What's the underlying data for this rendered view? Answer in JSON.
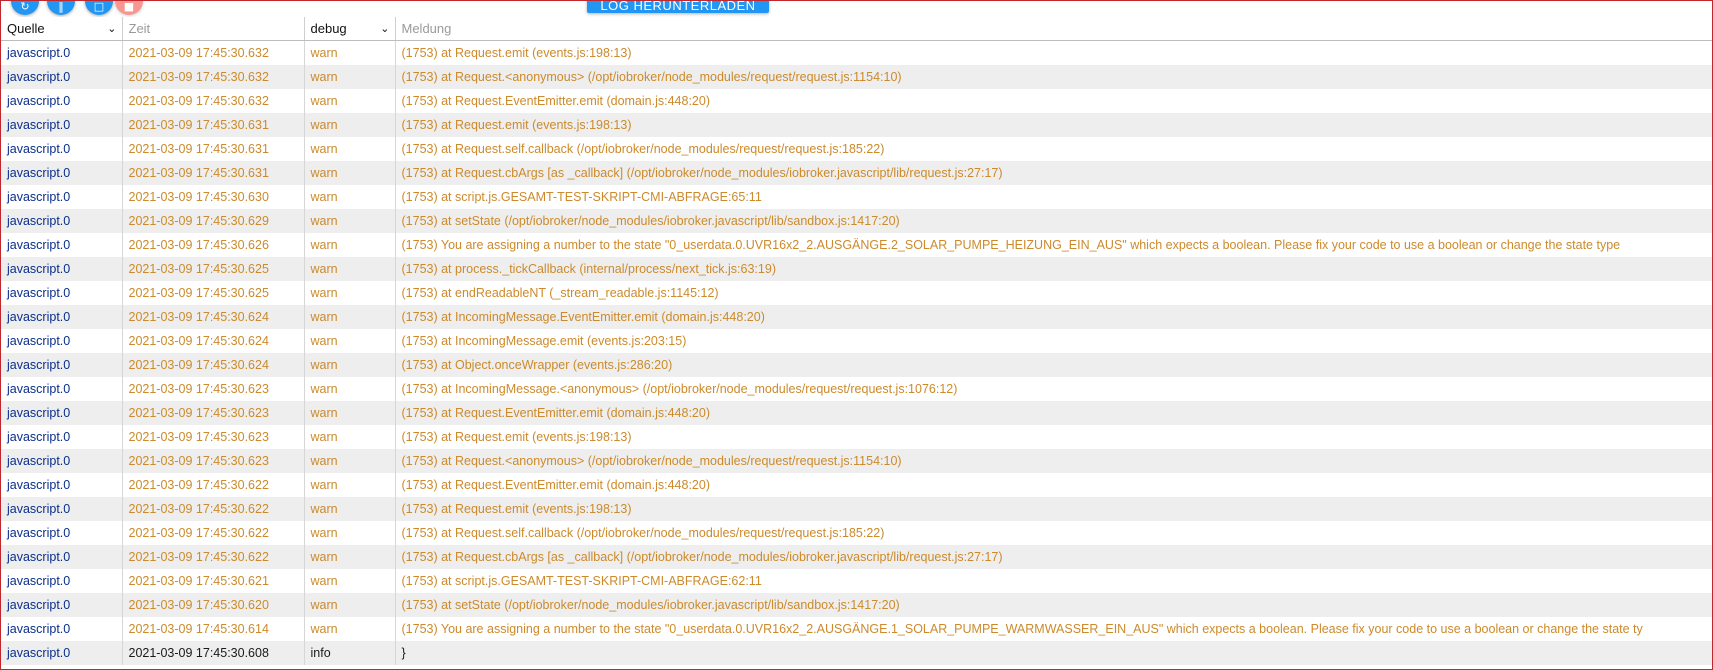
{
  "toolbar": {
    "download_label": "LOG HERUNTERLADEN",
    "icons": [
      "refresh-icon",
      "pause-icon",
      "clear-icon",
      "delete-icon"
    ]
  },
  "header": {
    "source_filter": "Quelle",
    "time_filter_placeholder": "Zeit",
    "severity_filter": "debug",
    "message_filter_placeholder": "Meldung"
  },
  "colors": {
    "warn_text": "#cc8a2c",
    "source_text": "#0b2f8a",
    "frame_border": "#c1272d",
    "button_blue": "#2196f3"
  },
  "rows": [
    {
      "source": "javascript.0",
      "time": "2021-03-09 17:45:30.632",
      "severity": "warn",
      "message": "(1753) at Request.emit (events.js:198:13)"
    },
    {
      "source": "javascript.0",
      "time": "2021-03-09 17:45:30.632",
      "severity": "warn",
      "message": "(1753) at Request.<anonymous> (/opt/iobroker/node_modules/request/request.js:1154:10)"
    },
    {
      "source": "javascript.0",
      "time": "2021-03-09 17:45:30.632",
      "severity": "warn",
      "message": "(1753) at Request.EventEmitter.emit (domain.js:448:20)"
    },
    {
      "source": "javascript.0",
      "time": "2021-03-09 17:45:30.631",
      "severity": "warn",
      "message": "(1753) at Request.emit (events.js:198:13)"
    },
    {
      "source": "javascript.0",
      "time": "2021-03-09 17:45:30.631",
      "severity": "warn",
      "message": "(1753) at Request.self.callback (/opt/iobroker/node_modules/request/request.js:185:22)"
    },
    {
      "source": "javascript.0",
      "time": "2021-03-09 17:45:30.631",
      "severity": "warn",
      "message": "(1753) at Request.cbArgs [as _callback] (/opt/iobroker/node_modules/iobroker.javascript/lib/request.js:27:17)"
    },
    {
      "source": "javascript.0",
      "time": "2021-03-09 17:45:30.630",
      "severity": "warn",
      "message": "(1753) at script.js.GESAMT-TEST-SKRIPT-CMI-ABFRAGE:65:11"
    },
    {
      "source": "javascript.0",
      "time": "2021-03-09 17:45:30.629",
      "severity": "warn",
      "message": "(1753) at setState (/opt/iobroker/node_modules/iobroker.javascript/lib/sandbox.js:1417:20)"
    },
    {
      "source": "javascript.0",
      "time": "2021-03-09 17:45:30.626",
      "severity": "warn",
      "message": "(1753) You are assigning a number to the state \"0_userdata.0.UVR16x2_2.AUSGÄNGE.2_SOLAR_PUMPE_HEIZUNG_EIN_AUS\" which expects a boolean. Please fix your code to use a boolean or change the state type"
    },
    {
      "source": "javascript.0",
      "time": "2021-03-09 17:45:30.625",
      "severity": "warn",
      "message": "(1753) at process._tickCallback (internal/process/next_tick.js:63:19)"
    },
    {
      "source": "javascript.0",
      "time": "2021-03-09 17:45:30.625",
      "severity": "warn",
      "message": "(1753) at endReadableNT (_stream_readable.js:1145:12)"
    },
    {
      "source": "javascript.0",
      "time": "2021-03-09 17:45:30.624",
      "severity": "warn",
      "message": "(1753) at IncomingMessage.EventEmitter.emit (domain.js:448:20)"
    },
    {
      "source": "javascript.0",
      "time": "2021-03-09 17:45:30.624",
      "severity": "warn",
      "message": "(1753) at IncomingMessage.emit (events.js:203:15)"
    },
    {
      "source": "javascript.0",
      "time": "2021-03-09 17:45:30.624",
      "severity": "warn",
      "message": "(1753) at Object.onceWrapper (events.js:286:20)"
    },
    {
      "source": "javascript.0",
      "time": "2021-03-09 17:45:30.623",
      "severity": "warn",
      "message": "(1753) at IncomingMessage.<anonymous> (/opt/iobroker/node_modules/request/request.js:1076:12)"
    },
    {
      "source": "javascript.0",
      "time": "2021-03-09 17:45:30.623",
      "severity": "warn",
      "message": "(1753) at Request.EventEmitter.emit (domain.js:448:20)"
    },
    {
      "source": "javascript.0",
      "time": "2021-03-09 17:45:30.623",
      "severity": "warn",
      "message": "(1753) at Request.emit (events.js:198:13)"
    },
    {
      "source": "javascript.0",
      "time": "2021-03-09 17:45:30.623",
      "severity": "warn",
      "message": "(1753) at Request.<anonymous> (/opt/iobroker/node_modules/request/request.js:1154:10)"
    },
    {
      "source": "javascript.0",
      "time": "2021-03-09 17:45:30.622",
      "severity": "warn",
      "message": "(1753) at Request.EventEmitter.emit (domain.js:448:20)"
    },
    {
      "source": "javascript.0",
      "time": "2021-03-09 17:45:30.622",
      "severity": "warn",
      "message": "(1753) at Request.emit (events.js:198:13)"
    },
    {
      "source": "javascript.0",
      "time": "2021-03-09 17:45:30.622",
      "severity": "warn",
      "message": "(1753) at Request.self.callback (/opt/iobroker/node_modules/request/request.js:185:22)"
    },
    {
      "source": "javascript.0",
      "time": "2021-03-09 17:45:30.622",
      "severity": "warn",
      "message": "(1753) at Request.cbArgs [as _callback] (/opt/iobroker/node_modules/iobroker.javascript/lib/request.js:27:17)"
    },
    {
      "source": "javascript.0",
      "time": "2021-03-09 17:45:30.621",
      "severity": "warn",
      "message": "(1753) at script.js.GESAMT-TEST-SKRIPT-CMI-ABFRAGE:62:11"
    },
    {
      "source": "javascript.0",
      "time": "2021-03-09 17:45:30.620",
      "severity": "warn",
      "message": "(1753) at setState (/opt/iobroker/node_modules/iobroker.javascript/lib/sandbox.js:1417:20)"
    },
    {
      "source": "javascript.0",
      "time": "2021-03-09 17:45:30.614",
      "severity": "warn",
      "message": "(1753) You are assigning a number to the state \"0_userdata.0.UVR16x2_2.AUSGÄNGE.1_SOLAR_PUMPE_WARMWASSER_EIN_AUS\" which expects a boolean. Please fix your code to use a boolean or change the state ty"
    },
    {
      "source": "javascript.0",
      "time": "2021-03-09 17:45:30.608",
      "severity": "info",
      "message": "}"
    }
  ]
}
